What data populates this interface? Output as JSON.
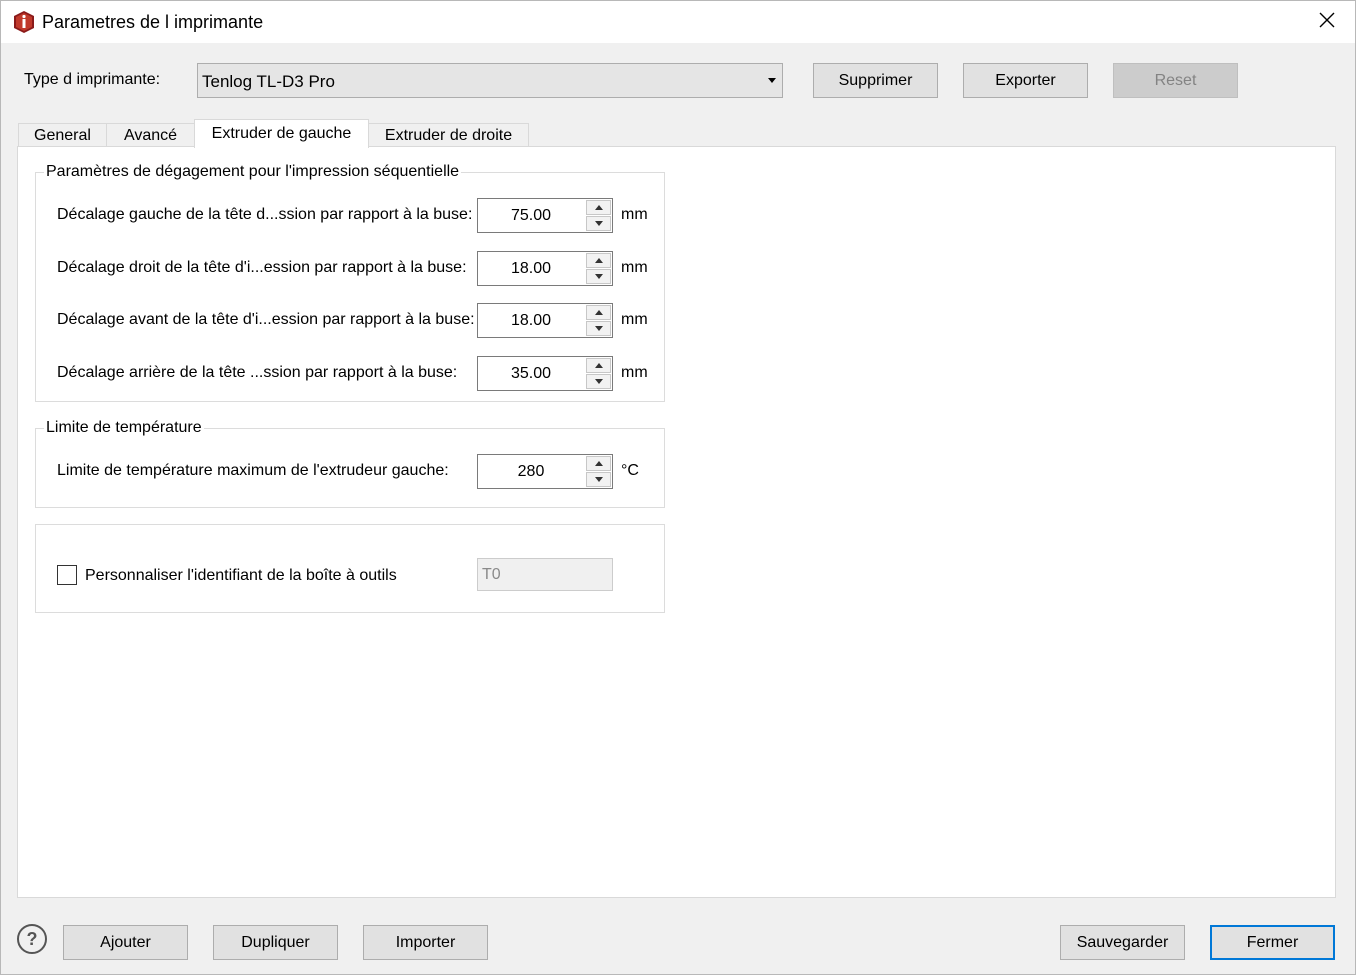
{
  "window": {
    "title": "Parametres de l imprimante"
  },
  "printer": {
    "type_label": "Type d imprimante:",
    "selected": "Tenlog TL-D3 Pro",
    "buttons": {
      "delete": "Supprimer",
      "export": "Exporter",
      "reset": "Reset"
    }
  },
  "tabs": [
    {
      "label": "General"
    },
    {
      "label": "Avancé"
    },
    {
      "label": "Extruder de gauche"
    },
    {
      "label": "Extruder de droite"
    }
  ],
  "active_tab": "Extruder de gauche",
  "clearance": {
    "title": "Paramètres de dégagement pour l'impression séquentielle",
    "rows": [
      {
        "label": "Décalage gauche de la tête d...ssion par rapport à la buse:",
        "value": "75.00",
        "unit": "mm"
      },
      {
        "label": "Décalage droit de la tête d'i...ession par rapport à la buse:",
        "value": "18.00",
        "unit": "mm"
      },
      {
        "label": "Décalage avant de la tête d'i...ession par rapport à la buse:",
        "value": "18.00",
        "unit": "mm"
      },
      {
        "label": "Décalage arrière de la tête ...ssion par rapport à la buse:",
        "value": "35.00",
        "unit": "mm"
      }
    ]
  },
  "temperature": {
    "title": "Limite de température",
    "label": "Limite de température maximum de l'extrudeur gauche:",
    "value": "280",
    "unit": "°C"
  },
  "toolbox": {
    "checkbox_label": "Personnaliser l'identifiant de la boîte à outils",
    "checked": false,
    "id_value": "T0"
  },
  "footer": {
    "help": "?",
    "add": "Ajouter",
    "duplicate": "Dupliquer",
    "import": "Importer",
    "save": "Sauvegarder",
    "close": "Fermer"
  },
  "colors": {
    "accent": "#0078d7",
    "brand": "#b22222"
  }
}
